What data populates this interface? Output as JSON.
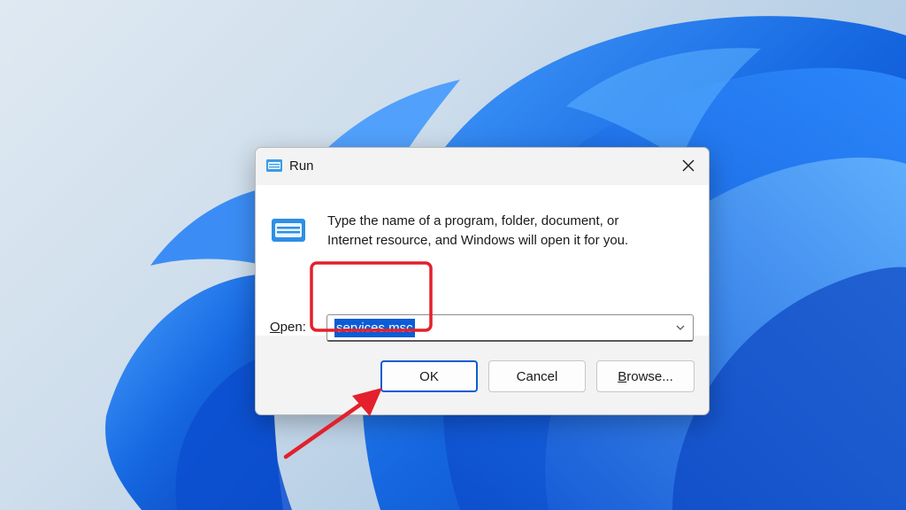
{
  "dialog": {
    "title": "Run",
    "description_line1": "Type the name of a program, folder, document, or",
    "description_line2": "Internet resource, and Windows will open it for you.",
    "open_label_underlined": "O",
    "open_label_rest": "pen:",
    "open_value": "services.msc",
    "ok_label": "OK",
    "cancel_label": "Cancel",
    "browse_label_underlined": "B",
    "browse_label_rest": "rowse..."
  },
  "icons": {
    "title": "run-app-icon",
    "content": "run-app-icon",
    "close": "close-icon",
    "dropdown": "chevron-down-icon"
  },
  "colors": {
    "accent": "#0b5cd6",
    "annotation": "#e3202b",
    "wallpaper_blue": "#1a6fe6"
  }
}
